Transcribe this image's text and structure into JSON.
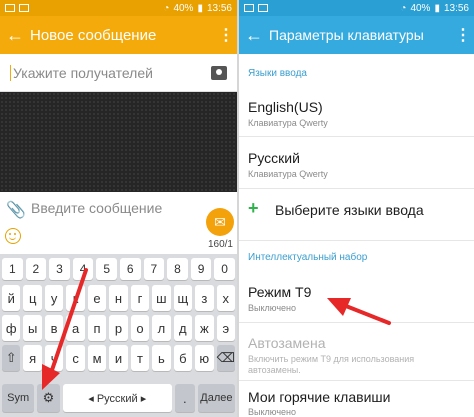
{
  "left_screen": {
    "status_bar": {
      "time": "13:56",
      "battery": "40%"
    },
    "app_bar": {
      "title": "Новое сообщение",
      "back_icon": "←",
      "menu_icon": "⋮"
    },
    "recipient": {
      "placeholder": "Укажите получателей"
    },
    "composer": {
      "placeholder": "Введите сообщение",
      "counter": "160/1",
      "send_icon": "✉"
    },
    "keyboard": {
      "row1": [
        "1",
        "2",
        "3",
        "4",
        "5",
        "6",
        "7",
        "8",
        "9",
        "0"
      ],
      "row2": [
        "й",
        "ц",
        "у",
        "к",
        "е",
        "н",
        "г",
        "ш",
        "щ",
        "з",
        "х"
      ],
      "row3": [
        "ф",
        "ы",
        "в",
        "а",
        "п",
        "р",
        "о",
        "л",
        "д",
        "ж",
        "э"
      ],
      "row4": [
        "⇧",
        "я",
        "ч",
        "с",
        "м",
        "и",
        "т",
        "ь",
        "б",
        "ю",
        "⌫"
      ],
      "row5": {
        "sym": "Sym",
        "settings_icon": "⚙",
        "space_label": "◂ Русский ▸",
        "dot": ".",
        "done": "Далее"
      }
    }
  },
  "right_screen": {
    "status_bar": {
      "time": "13:56",
      "battery": "40%"
    },
    "app_bar": {
      "title": "Параметры клавиатуры",
      "back_icon": "←",
      "menu_icon": "⋮"
    },
    "section_input_languages": "Языки ввода",
    "languages": [
      {
        "title": "English(US)",
        "subtitle": "Клавиатура Qwerty"
      },
      {
        "title": "Русский",
        "subtitle": "Клавиатура Qwerty"
      }
    ],
    "select_languages": "Выберите языки ввода",
    "section_smart_typing": "Интеллектуальный набор",
    "t9": {
      "title": "Режим Т9",
      "subtitle": "Выключено"
    },
    "autocorrect": {
      "title": "Автозамена",
      "subtitle_line1": "Включить режим Т9 для использования",
      "subtitle_line2": "автозамены."
    },
    "hotkeys": {
      "title": "Мои горячие клавиши",
      "subtitle": "Выключено"
    }
  },
  "colors": {
    "left_accent": "#f4aa0b",
    "right_accent": "#35aadf",
    "arrow": "#e62828"
  }
}
